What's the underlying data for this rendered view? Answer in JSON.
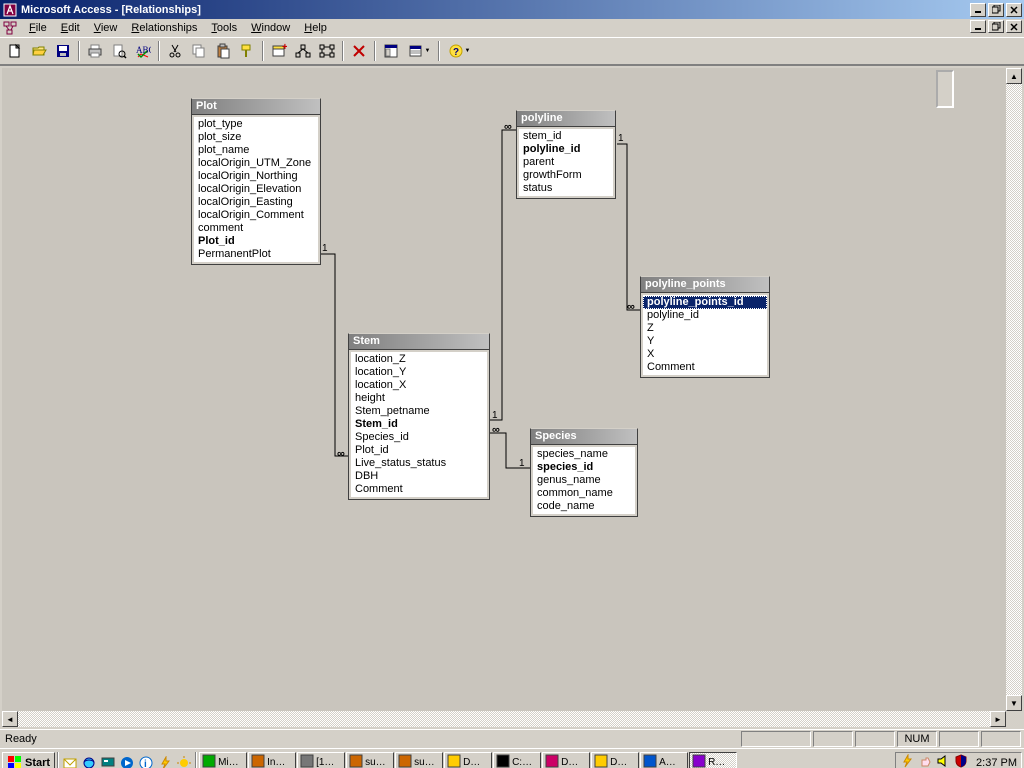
{
  "window": {
    "title": "Microsoft Access - [Relationships]"
  },
  "menus": {
    "file": "File",
    "edit": "Edit",
    "view": "View",
    "relationships": "Relationships",
    "tools": "Tools",
    "window": "Window",
    "help": "Help"
  },
  "tables": {
    "plot": {
      "name": "Plot",
      "fields": [
        {
          "name": "plot_type",
          "pk": false
        },
        {
          "name": "plot_size",
          "pk": false
        },
        {
          "name": "plot_name",
          "pk": false
        },
        {
          "name": "localOrigin_UTM_Zone",
          "pk": false
        },
        {
          "name": "localOrigin_Northing",
          "pk": false
        },
        {
          "name": "localOrigin_Elevation",
          "pk": false
        },
        {
          "name": "localOrigin_Easting",
          "pk": false
        },
        {
          "name": "localOrigin_Comment",
          "pk": false
        },
        {
          "name": "comment",
          "pk": false
        },
        {
          "name": "Plot_id",
          "pk": true
        },
        {
          "name": "PermanentPlot",
          "pk": false
        }
      ]
    },
    "polyline": {
      "name": "polyline",
      "fields": [
        {
          "name": "stem_id",
          "pk": false
        },
        {
          "name": "polyline_id",
          "pk": true
        },
        {
          "name": "parent",
          "pk": false
        },
        {
          "name": "growthForm",
          "pk": false
        },
        {
          "name": "status",
          "pk": false
        }
      ]
    },
    "polyline_points": {
      "name": "polyline_points",
      "fields": [
        {
          "name": "polyline_points_id",
          "pk": true,
          "selected": true
        },
        {
          "name": "polyline_id",
          "pk": false
        },
        {
          "name": "Z",
          "pk": false
        },
        {
          "name": "Y",
          "pk": false
        },
        {
          "name": "X",
          "pk": false
        },
        {
          "name": "Comment",
          "pk": false
        }
      ]
    },
    "stem": {
      "name": "Stem",
      "fields": [
        {
          "name": "location_Z",
          "pk": false
        },
        {
          "name": "location_Y",
          "pk": false
        },
        {
          "name": "location_X",
          "pk": false
        },
        {
          "name": "height",
          "pk": false
        },
        {
          "name": "Stem_petname",
          "pk": false
        },
        {
          "name": "Stem_id",
          "pk": true
        },
        {
          "name": "Species_id",
          "pk": false
        },
        {
          "name": "Plot_id",
          "pk": false
        },
        {
          "name": "Live_status_status",
          "pk": false
        },
        {
          "name": "DBH",
          "pk": false
        },
        {
          "name": "Comment",
          "pk": false
        }
      ]
    },
    "species": {
      "name": "Species",
      "fields": [
        {
          "name": "species_name",
          "pk": false
        },
        {
          "name": "species_id",
          "pk": true
        },
        {
          "name": "genus_name",
          "pk": false
        },
        {
          "name": "common_name",
          "pk": false
        },
        {
          "name": "code_name",
          "pk": false
        }
      ]
    }
  },
  "relationships": {
    "one": "1",
    "many": "∞"
  },
  "status": {
    "ready": "Ready",
    "num": "NUM"
  },
  "taskbar": {
    "start": "Start",
    "time": "2:37 PM",
    "tasks": [
      "Mi…",
      "In…",
      "[1…",
      "su…",
      "su…",
      "D…",
      "C:…",
      "D…",
      "D…",
      "A…",
      "R…"
    ]
  }
}
